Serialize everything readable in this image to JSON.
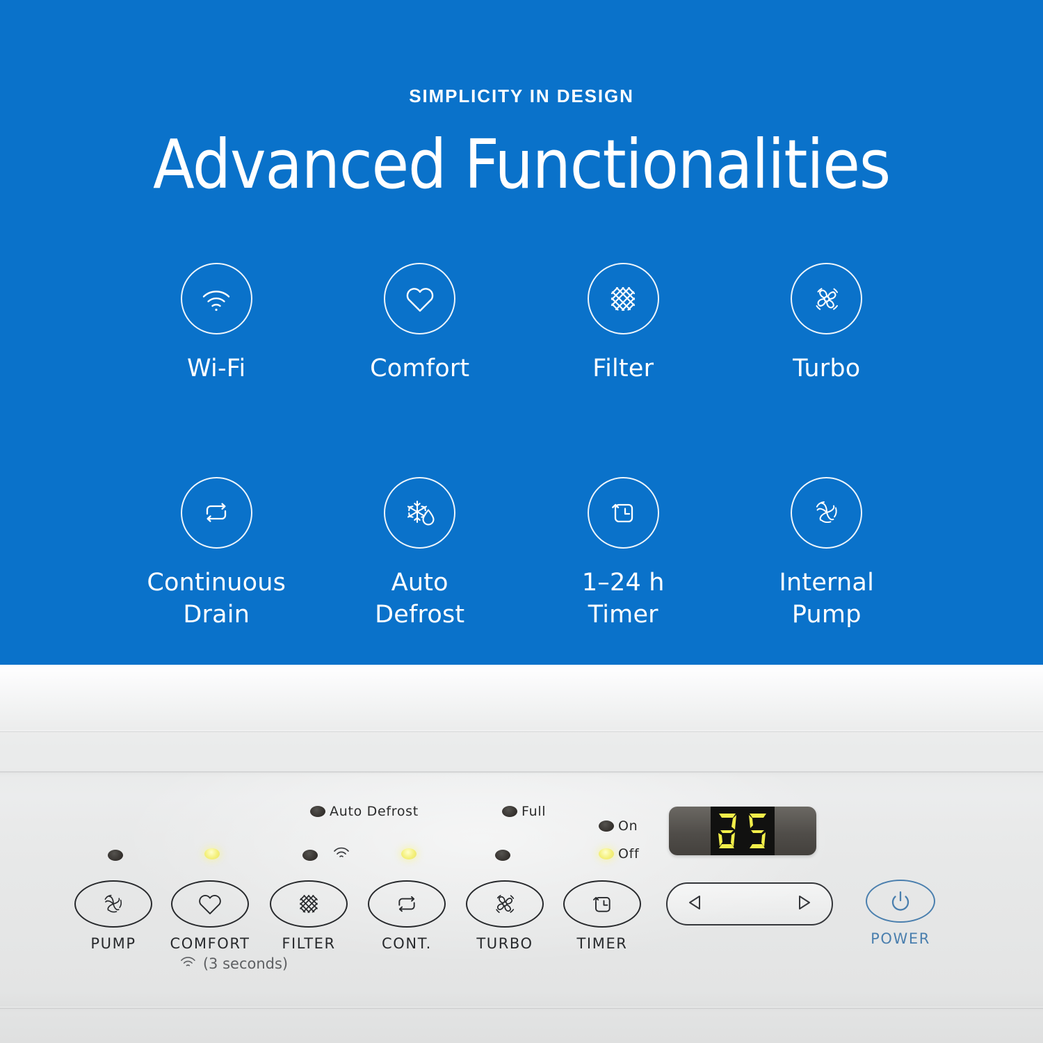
{
  "hero": {
    "kicker": "SIMPLICITY IN DESIGN",
    "headline": "Advanced Functionalities",
    "background_color": "#0a72ca",
    "text_color": "#ffffff"
  },
  "features": [
    {
      "icon": "wifi-icon",
      "label": "Wi-Fi"
    },
    {
      "icon": "heart-icon",
      "label": "Comfort"
    },
    {
      "icon": "filter-mesh-icon",
      "label": "Filter"
    },
    {
      "icon": "fan-turbo-icon",
      "label": "Turbo"
    },
    {
      "icon": "loop-arrows-icon",
      "label": "Continuous\nDrain"
    },
    {
      "icon": "snowflake-drop-icon",
      "label": "Auto\nDefrost"
    },
    {
      "icon": "clock-timer-icon",
      "label": "1–24 h\nTimer"
    },
    {
      "icon": "impeller-pump-icon",
      "label": "Internal\nPump"
    }
  ],
  "control_panel": {
    "indicators": [
      {
        "name": "auto-defrost-indicator",
        "label": "Auto Defrost",
        "state": "off"
      },
      {
        "name": "full-indicator",
        "label": "Full",
        "state": "off"
      },
      {
        "name": "on-indicator",
        "label": "On",
        "state": "off"
      },
      {
        "name": "off-indicator",
        "label": "Off",
        "state": "lit"
      }
    ],
    "button_leds": [
      {
        "for": "PUMP",
        "state": "off"
      },
      {
        "for": "COMFORT",
        "state": "lit"
      },
      {
        "for": "FILTER",
        "state": "off"
      },
      {
        "for": "CONT.",
        "state": "lit"
      },
      {
        "for": "TURBO",
        "state": "off"
      },
      {
        "for": "TIMER",
        "state": "off"
      }
    ],
    "buttons": [
      {
        "label": "PUMP",
        "icon": "impeller-pump-icon"
      },
      {
        "label": "COMFORT",
        "icon": "heart-icon"
      },
      {
        "label": "FILTER",
        "icon": "filter-mesh-icon"
      },
      {
        "label": "CONT.",
        "icon": "loop-arrows-icon"
      },
      {
        "label": "TURBO",
        "icon": "fan-turbo-icon"
      },
      {
        "label": "TIMER",
        "icon": "clock-timer-icon"
      }
    ],
    "comfort_hint": "(3 seconds)",
    "comfort_hint_icon": "wifi-icon",
    "filter_wifi_icon": "wifi-icon",
    "display": {
      "value": "35",
      "digit_color": "#f2ee4a",
      "bezel_color": "#504d49"
    },
    "rocker": {
      "left_icon": "triangle-left-icon",
      "right_icon": "triangle-right-icon"
    },
    "power": {
      "label": "POWER",
      "icon": "power-icon",
      "color": "#4a7fae"
    }
  }
}
